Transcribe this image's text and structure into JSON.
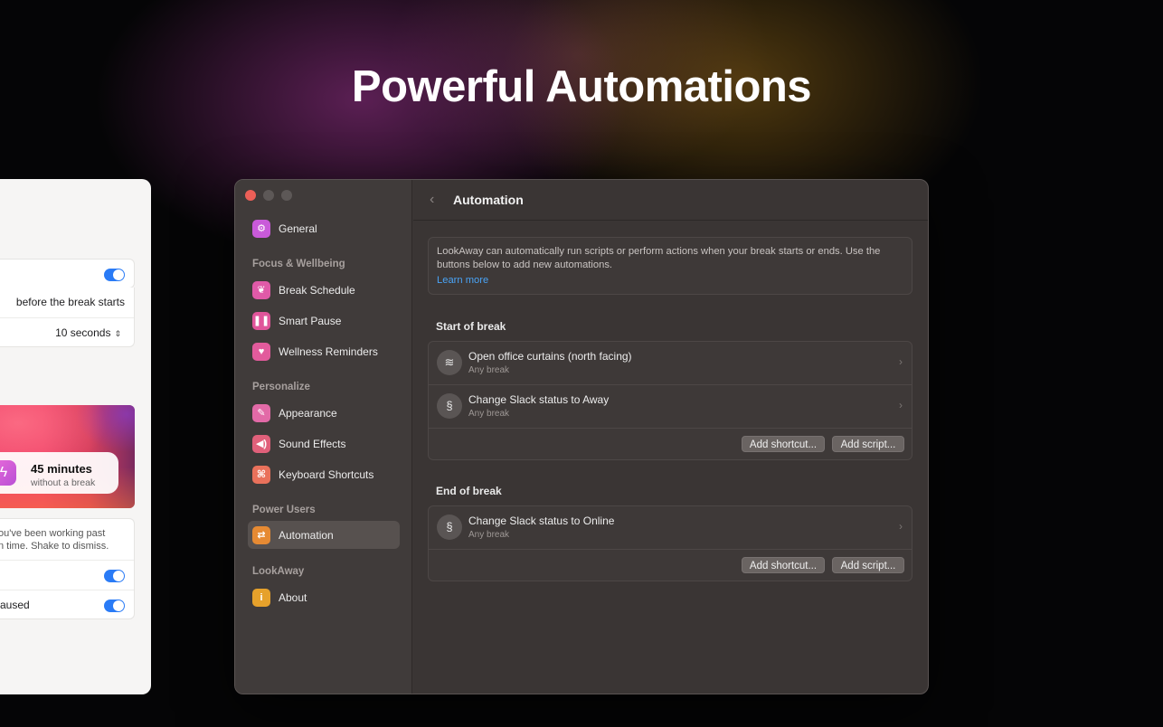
{
  "headline": "Powerful Automations",
  "background_window": {
    "row_before": "before the break starts",
    "row_seconds": "10 seconds",
    "card_title": "45 minutes",
    "card_subtitle": "without a break",
    "description_line1": "ou've been working past",
    "description_line2": "n time. Shake to dismiss.",
    "row_paused": "aused",
    "toggles_on": [
      true,
      true,
      true
    ]
  },
  "sidebar": {
    "general": "General",
    "sections": {
      "focus": "Focus & Wellbeing",
      "personalize": "Personalize",
      "power": "Power Users",
      "lookaway": "LookAway"
    },
    "items": {
      "break_schedule": "Break Schedule",
      "smart_pause": "Smart Pause",
      "wellness": "Wellness Reminders",
      "appearance": "Appearance",
      "sound": "Sound Effects",
      "shortcuts": "Keyboard Shortcuts",
      "automation": "Automation",
      "about": "About"
    },
    "colors": {
      "general": "#c95ad9",
      "break_schedule": "#e05aa8",
      "smart_pause": "#e0559a",
      "wellness": "#e25b9c",
      "appearance": "#e26aa7",
      "sound": "#e0607a",
      "shortcuts": "#e9715b",
      "automation": "#e68a33",
      "about": "#e6a12b"
    }
  },
  "content": {
    "title": "Automation",
    "info_text": "LookAway can automatically run scripts or perform actions when your break starts or ends. Use the buttons below to add new automations.",
    "learn_more": "Learn more",
    "start_group": {
      "title": "Start of break",
      "rows": [
        {
          "title": "Open office curtains (north facing)",
          "subtitle": "Any break",
          "icon": "layers-icon"
        },
        {
          "title": "Change Slack status to Away",
          "subtitle": "Any break",
          "icon": "shortcut-icon"
        }
      ]
    },
    "end_group": {
      "title": "End of break",
      "rows": [
        {
          "title": "Change Slack status to Online",
          "subtitle": "Any break",
          "icon": "shortcut-icon"
        }
      ]
    },
    "add_shortcut": "Add shortcut...",
    "add_script": "Add script..."
  }
}
